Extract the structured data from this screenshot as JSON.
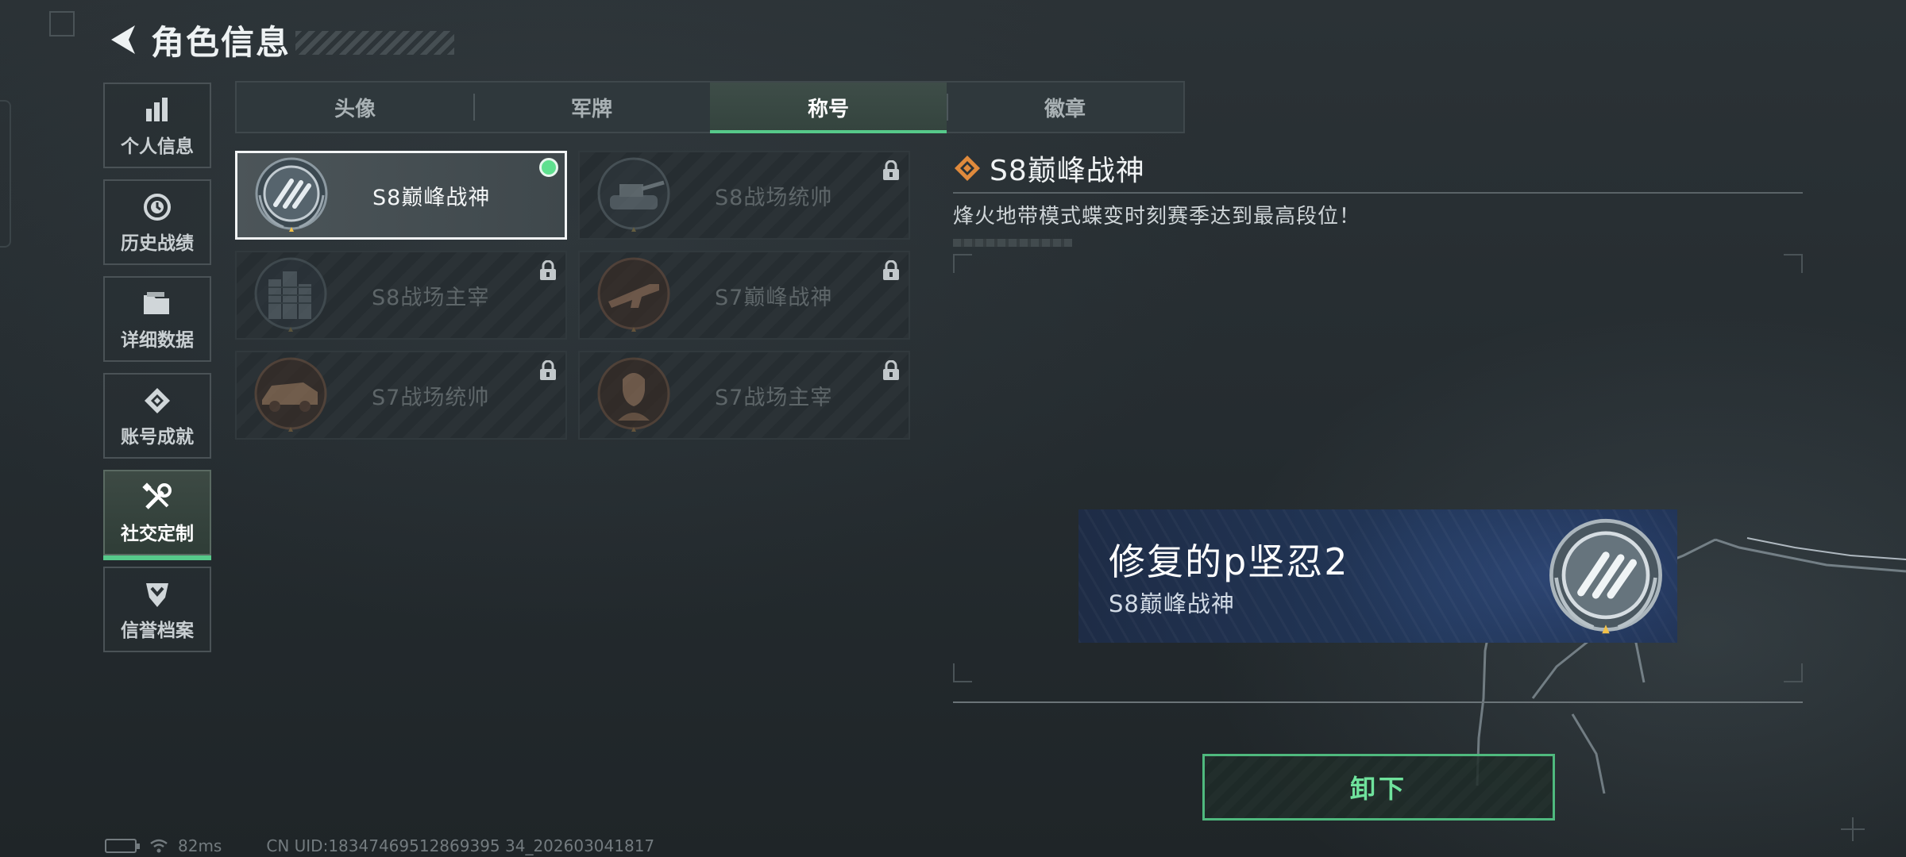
{
  "header": {
    "title": "角色信息"
  },
  "nav": {
    "items": [
      {
        "label": "个人信息",
        "icon": "bar-chart-icon"
      },
      {
        "label": "历史战绩",
        "icon": "history-clock-icon"
      },
      {
        "label": "详细数据",
        "icon": "folder-icon"
      },
      {
        "label": "账号成就",
        "icon": "achievement-diamond-icon"
      },
      {
        "label": "社交定制",
        "icon": "wrench-screwdriver-icon",
        "active": true
      },
      {
        "label": "信誉档案",
        "icon": "shield-chevron-icon"
      }
    ]
  },
  "tabs": [
    {
      "label": "头像"
    },
    {
      "label": "军牌"
    },
    {
      "label": "称号",
      "active": true
    },
    {
      "label": "徽章"
    }
  ],
  "titles": [
    {
      "label": "S8巅峰战神",
      "state": "equipped",
      "emblem": "peak-god-emblem-icon"
    },
    {
      "label": "S8战场统帅",
      "state": "locked",
      "emblem": "tank-emblem-icon"
    },
    {
      "label": "S8战场主宰",
      "state": "locked",
      "emblem": "building-emblem-icon"
    },
    {
      "label": "S7巅峰战神",
      "state": "locked",
      "emblem": "rifle-emblem-icon"
    },
    {
      "label": "S7战场统帅",
      "state": "locked",
      "emblem": "armored-vehicle-emblem-icon"
    },
    {
      "label": "S7战场主宰",
      "state": "locked",
      "emblem": "soldier-emblem-icon"
    }
  ],
  "detail": {
    "title": "S8巅峰战神",
    "description": "烽火地带模式蝶变时刻赛季达到最高段位！"
  },
  "nameplate": {
    "player_name": "修复的p坚忍2",
    "title": "S8巅峰战神"
  },
  "actions": {
    "unequip_label": "卸下"
  },
  "status": {
    "ping": "82ms",
    "uid": "CN UID:18347469512869395 34_202603041817"
  },
  "colors": {
    "accent_green": "#56c98a",
    "equipped_dot": "#5fe08f",
    "diamond_orange": "#e08a3c",
    "nameplate_blue": "#223759"
  }
}
